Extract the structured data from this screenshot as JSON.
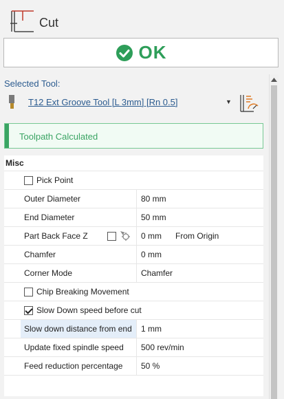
{
  "header": {
    "title": "Cut",
    "icon": "cut-operation-icon"
  },
  "ok_button": {
    "label": "OK",
    "icon": "check-circle-icon",
    "color": "#2e9e59"
  },
  "selected_tool": {
    "label": "Selected Tool",
    "tool_name": "T12 Ext Groove Tool [L 3mm] [Rn 0.5]",
    "tool_icon": "groove-tool-icon",
    "library_icon": "tool-library-icon"
  },
  "status": {
    "text": "Toolpath Calculated",
    "color": "#3aa463"
  },
  "misc": {
    "header": "Misc",
    "pick_point": {
      "label": "Pick Point",
      "checked": false
    },
    "outer_diameter": {
      "label": "Outer Diameter",
      "value": "80 mm"
    },
    "end_diameter": {
      "label": "End Diameter",
      "value": "50 mm"
    },
    "part_back_face_z": {
      "label": "Part Back Face Z",
      "value": "0 mm",
      "extra": "From Origin"
    },
    "chamfer": {
      "label": "Chamfer",
      "value": "0 mm"
    },
    "corner_mode": {
      "label": "Corner Mode",
      "value": "Chamfer"
    },
    "chip_breaking": {
      "label": "Chip Breaking Movement",
      "checked": false
    },
    "slow_down": {
      "label": "Slow Down speed before cut",
      "checked": true
    },
    "slow_down_distance": {
      "label": "Slow down distance from end",
      "value": "1 mm"
    },
    "update_spindle": {
      "label": "Update fixed spindle speed",
      "value": "500 rev/min"
    },
    "feed_reduction": {
      "label": "Feed reduction percentage",
      "value": "50 %"
    }
  }
}
